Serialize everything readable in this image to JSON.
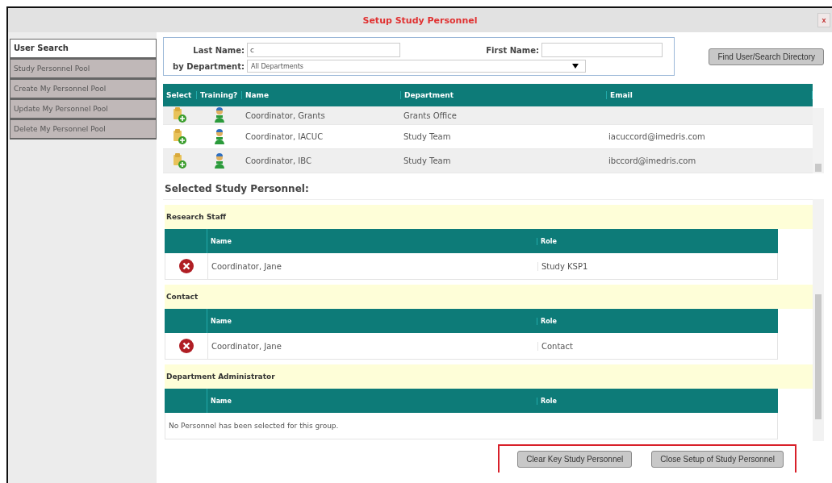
{
  "window": {
    "title": "Setup Study Personnel",
    "close": "x"
  },
  "sidebar": {
    "items": [
      {
        "label": "User Search",
        "selected": true
      },
      {
        "label": "Study Personnel Pool",
        "selected": false
      },
      {
        "label": "Create My Personnel Pool",
        "selected": false
      },
      {
        "label": "Update My Personnel Pool",
        "selected": false
      },
      {
        "label": "Delete My Personnel Pool",
        "selected": false
      }
    ]
  },
  "search": {
    "last_name_label": "Last Name:",
    "last_name_value": "c",
    "first_name_label": "First Name:",
    "department_label": "by Department:",
    "department_value": "All Departments",
    "find_button": "Find User/Search Directory"
  },
  "results": {
    "columns": [
      "Select",
      "Training?",
      "Name",
      "Department",
      "Email"
    ],
    "rows": [
      {
        "name": "Coordinator, Grants",
        "department": "Grants Office",
        "email": ""
      },
      {
        "name": "Coordinator, IACUC",
        "department": "Study Team",
        "email": "iacuccord@imedris.com"
      },
      {
        "name": "Coordinator, IBC",
        "department": "Study Team",
        "email": "ibccord@imedris.com"
      }
    ]
  },
  "selected": {
    "heading": "Selected Study Personnel:",
    "groups": [
      {
        "title": "Research Staff",
        "columns": [
          "Name",
          "Role"
        ],
        "rows": [
          {
            "name": "Coordinator, Jane",
            "role": "Study KSP1"
          }
        ]
      },
      {
        "title": "Contact",
        "columns": [
          "Name",
          "Role"
        ],
        "rows": [
          {
            "name": "Coordinator, Jane",
            "role": "Contact"
          }
        ]
      },
      {
        "title": "Department Administrator",
        "columns": [
          "Name",
          "Role"
        ],
        "empty_message": "No Personnel has been selected for this group."
      }
    ]
  },
  "buttons": [
    "Clear Key Study Personnel",
    "Close Setup of Study Personnel"
  ]
}
